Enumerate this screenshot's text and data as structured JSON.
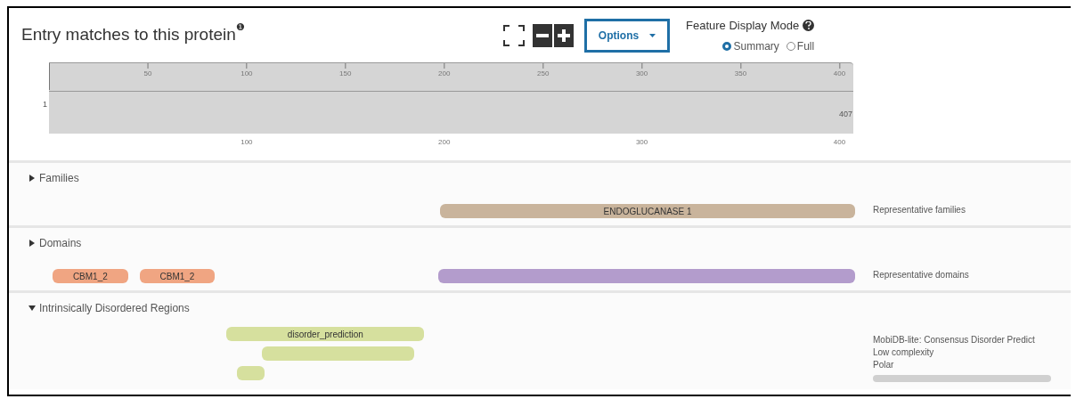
{
  "header": {
    "title": "Entry matches to this protein",
    "info_mark": "❶"
  },
  "toolbar": {
    "options_label": "Options",
    "mode_label": "Feature Display Mode",
    "modes": [
      {
        "label": "Summary",
        "selected": true
      },
      {
        "label": "Full",
        "selected": false
      }
    ]
  },
  "ruler": {
    "start_label": "1",
    "end_label": "407",
    "top_ticks": [
      "50",
      "100",
      "150",
      "200",
      "250",
      "300",
      "350",
      "400"
    ],
    "bottom_ticks": [
      "100",
      "200",
      "300",
      "400"
    ]
  },
  "sections": [
    {
      "name": "Families",
      "expanded": false,
      "legend": [
        "Representative families"
      ],
      "show_scroll": false,
      "rows": [
        [
          {
            "label": "ENDOGLUCANASE 1",
            "color": "#c9b49c"
          }
        ]
      ]
    },
    {
      "name": "Domains",
      "expanded": false,
      "legend": [
        "Representative domains"
      ],
      "show_scroll": false,
      "rows": [
        [
          {
            "label": "CBM1_2",
            "color": "#f0a582"
          },
          {
            "label": "CBM1_2",
            "color": "#f0a582"
          },
          {
            "color": "#b39ccc"
          }
        ]
      ]
    },
    {
      "name": "Intrinsically Disordered Regions",
      "expanded": true,
      "legend": [
        "MobiDB-lite: Consensus Disorder Predict",
        "Low complexity",
        "Polar"
      ],
      "show_scroll": true,
      "rows": [
        [
          {
            "label": "disorder_prediction",
            "color": "#d6e09e"
          }
        ],
        [
          {
            "color": "#d6e09e"
          }
        ],
        [
          {
            "color": "#d6e09e"
          }
        ]
      ]
    }
  ]
}
